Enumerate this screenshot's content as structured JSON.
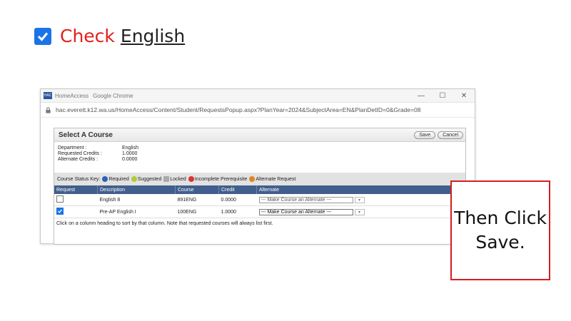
{
  "heading": {
    "word1": "Check",
    "word2": "English"
  },
  "browser": {
    "app_badge": "HAC",
    "window_title_1": "HomeAccess",
    "window_title_2": "Google Chrome",
    "controls": [
      "—",
      "☐",
      "✕"
    ],
    "url": "hac.everett.k12.wa.us/HomeAccess/Content/Student/RequestsPopup.aspx?PlanYear=2024&SubjectArea=EN&PlanDetID=0&Grade=08"
  },
  "dialog": {
    "title": "Select A Course",
    "save_label": "Save",
    "cancel_label": "Cancel",
    "department_label": "Department :",
    "department_value": "English",
    "requested_label": "Requested Credits :",
    "requested_value": "1.0000",
    "alternate_label": "Alternate Credits :",
    "alternate_value": "0.0000",
    "key_label": "Course Status Key:",
    "key_items": [
      "Required",
      "Suggested",
      "Locked",
      "Incomplete Prerequisite",
      "Alternate Request"
    ],
    "columns": [
      "Request",
      "Description",
      "Course",
      "Credit",
      "Alternate"
    ],
    "rows": [
      {
        "checked": false,
        "description": "English 8",
        "course": "891ENG",
        "credit": "0.0000",
        "alternate": "--- Make Course an Alternate ---"
      },
      {
        "checked": true,
        "description": "Pre-AP English I",
        "course": "100ENG",
        "credit": "1.0000",
        "alternate": "--- Make Course an Alternate ---"
      }
    ],
    "note": "Click on a column heading to sort by that column. Note that requested courses will always list first."
  },
  "callout": {
    "line1": "Then Click",
    "line2": "Save."
  },
  "colors": {
    "accent_red": "#e0201b",
    "check_blue": "#1a73e8",
    "table_header": "#415f8c",
    "callout_border": "#d21f1f"
  }
}
